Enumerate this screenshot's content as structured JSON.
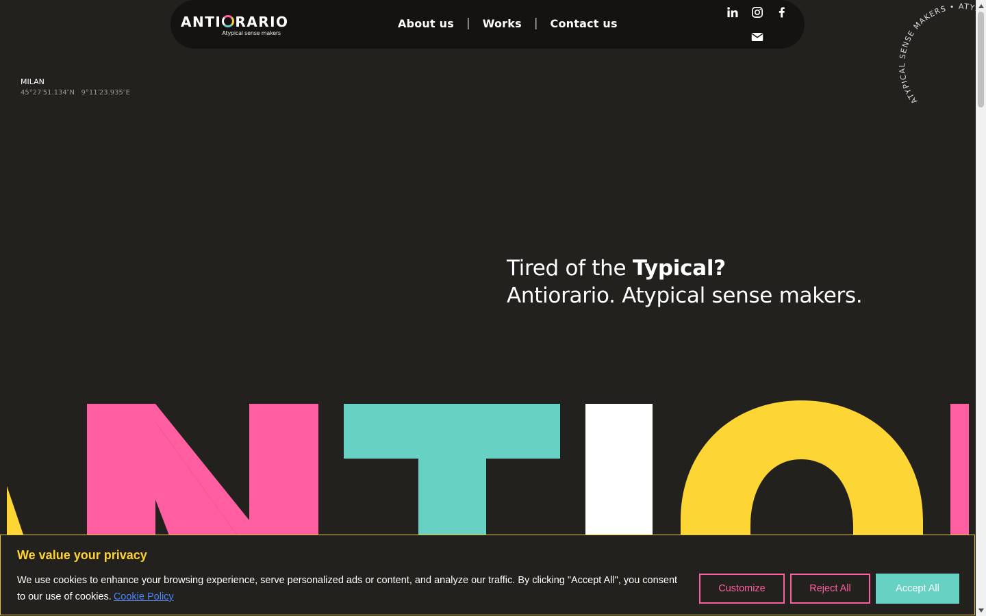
{
  "nav": {
    "logo_text_left": "ANTI",
    "logo_text_right": "RARIO",
    "logo_tagline": "Atypical sense makers",
    "links": [
      {
        "label": "About us"
      },
      {
        "label": "Works"
      },
      {
        "label": "Contact us"
      }
    ],
    "separator": "|",
    "socials": [
      "linkedin-icon",
      "instagram-icon",
      "facebook-icon",
      "envelope-icon"
    ]
  },
  "location": {
    "city": "MILAN",
    "latitude": "45°27′51.134″N",
    "longitude": "9°11′23.935″E"
  },
  "badge": {
    "text": "ATYPICAL SENSE MAKERS • ATYPICAL SENSE MAKERS • "
  },
  "hero": {
    "line1_prefix": "Tired of the ",
    "line1_bold": "Typical?",
    "line2": "Antiorario. Atypical sense makers."
  },
  "giant_letters": {
    "colors": {
      "pink": "#ff5fa0",
      "teal": "#67d1c3",
      "white": "#ffffff",
      "yellow": "#fdd535"
    }
  },
  "cookie": {
    "title": "We value your privacy",
    "text": "We use cookies to enhance your browsing experience, serve personalized ads or content, and analyze our traffic. By clicking \"Accept All\", you consent to our use of cookies.",
    "link": "Cookie Policy",
    "buttons": {
      "customize": "Customize",
      "reject": "Reject All",
      "accept": "Accept All"
    }
  },
  "colors": {
    "background": "#23211e",
    "navbar": "#141311",
    "accent_pink": "#ff5fa0",
    "accent_teal": "#67d1c3",
    "accent_yellow": "#ffd233",
    "link_blue": "#4a86f7"
  }
}
